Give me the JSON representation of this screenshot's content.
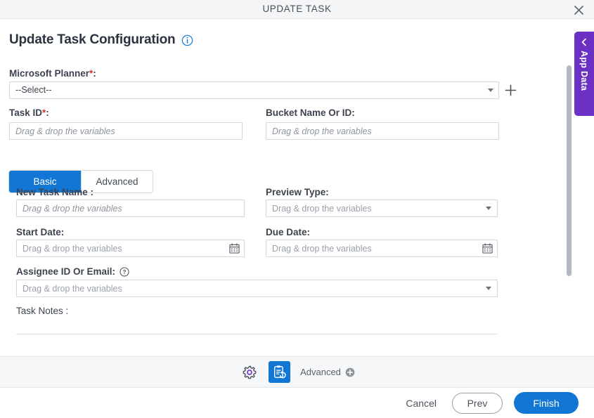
{
  "window": {
    "title": "UPDATE TASK",
    "close_icon": "close-icon"
  },
  "page": {
    "heading": "Update Task Configuration",
    "info_icon": "info-icon"
  },
  "fields": {
    "planner": {
      "label": "Microsoft Planner",
      "required_mark": "*",
      "colon": ":",
      "value": "--Select--",
      "add_icon": "plus-icon"
    },
    "task_id": {
      "label": "Task ID",
      "required_mark": "*",
      "colon": ":",
      "placeholder": "Drag & drop the variables",
      "value": ""
    },
    "bucket": {
      "label": "Bucket Name Or ID:",
      "placeholder": "Drag & drop the variables",
      "value": ""
    },
    "new_task_name": {
      "label": "New Task Name :",
      "placeholder": "Drag & drop the variables",
      "value": ""
    },
    "preview_type": {
      "label": "Preview Type:",
      "placeholder": "Drag & drop the variables",
      "value": ""
    },
    "start_date": {
      "label": "Start Date:",
      "placeholder": "Drag & drop the variables",
      "value": "",
      "icon": "calendar-icon"
    },
    "due_date": {
      "label": "Due Date:",
      "placeholder": "Drag & drop the variables",
      "value": "",
      "icon": "calendar-icon"
    },
    "assignee": {
      "label": "Assignee ID Or Email:",
      "help_icon": "help-icon",
      "placeholder": "Drag & drop the variables",
      "value": ""
    },
    "task_notes": {
      "label": "Task Notes :",
      "placeholder": "",
      "value": ""
    }
  },
  "tabs": [
    {
      "label": "Basic",
      "active": true
    },
    {
      "label": "Advanced",
      "active": false
    }
  ],
  "side_tab": {
    "label": "App Data",
    "collapse_icon": "chevron-left-icon"
  },
  "toolbar": {
    "settings_icon": "gear-icon",
    "task_icon": "task-config-icon",
    "advanced_label": "Advanced",
    "advanced_add_icon": "plus-circle-icon"
  },
  "footer": {
    "cancel_label": "Cancel",
    "prev_label": "Prev",
    "finish_label": "Finish"
  },
  "colors": {
    "accent_blue": "#1277d4",
    "app_data_purple": "#6b30c4",
    "required_red": "#d0342c",
    "titlebar_bg": "#f4f5f7",
    "toolstrip_bg": "#f6f7f9"
  }
}
